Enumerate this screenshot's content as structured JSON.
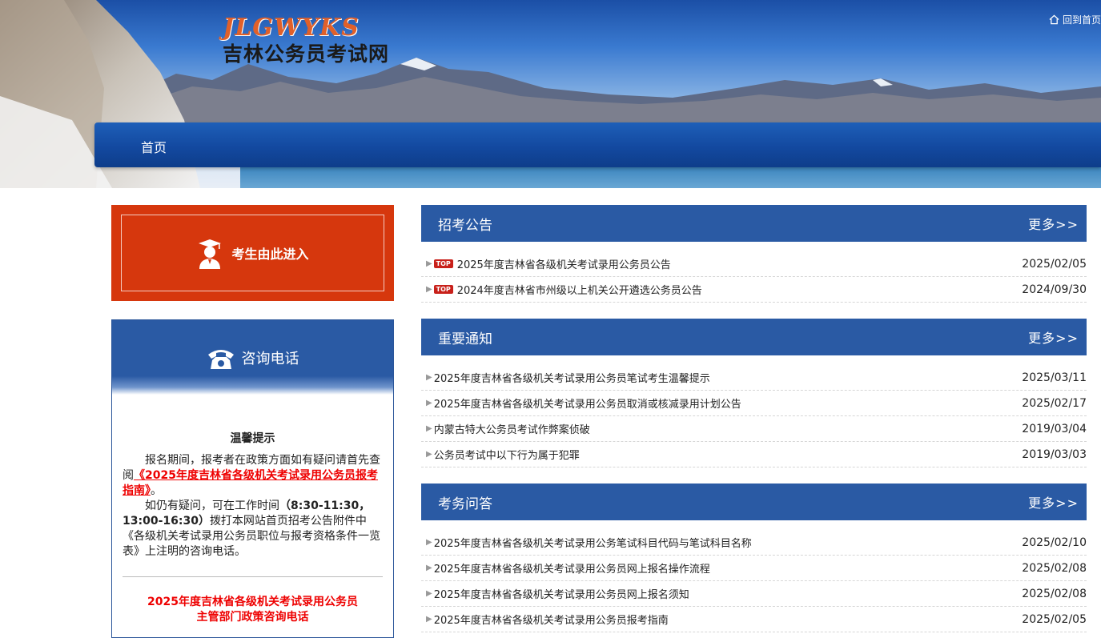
{
  "header": {
    "logo_mark": "JLGWYKS",
    "logo_sub": "吉林公务员考试网",
    "back_home": "回到首页",
    "home_icon": "home-icon"
  },
  "nav": {
    "items": [
      {
        "label": "首页"
      }
    ]
  },
  "left": {
    "enter_label": "考生由此进入",
    "enter_icon": "student-icon",
    "consult": {
      "title": "咨询电话",
      "icon": "phone-icon",
      "tip_title": "温馨提示",
      "tip_p1_pre": "报名期间，报考者在政策方面如有疑问请首先查阅",
      "tip_p1_link": "《2025年度吉林省各级机关考试录用公务员报考指南》",
      "tip_p1_post": "。",
      "tip_p2_pre": "如仍有疑问，可在工作时间",
      "tip_p2_bold": "（8:30-11:30，13:00-16:30）",
      "tip_p2_post": "拨打本网站首页招考公告附件中《各级机关考试录用公务员职位与报考资格条件一览表》上注明的咨询电话。",
      "red_title_1": "2025年度吉林省各级机关考试录用公务员",
      "red_title_2": "主管部门政策咨询电话"
    }
  },
  "sections": [
    {
      "title": "招考公告",
      "more": "更多>>",
      "items": [
        {
          "top": "TOP",
          "title": "2025年度吉林省各级机关考试录用公务员公告",
          "date": "2025/02/05"
        },
        {
          "top": "TOP",
          "title": "2024年度吉林省市州级以上机关公开遴选公务员公告",
          "date": "2024/09/30"
        }
      ]
    },
    {
      "title": "重要通知",
      "more": "更多>>",
      "items": [
        {
          "title": "2025年度吉林省各级机关考试录用公务员笔试考生温馨提示",
          "date": "2025/03/11"
        },
        {
          "title": "2025年度吉林省各级机关考试录用公务员取消或核减录用计划公告",
          "date": "2025/02/17"
        },
        {
          "title": "内蒙古特大公务员考试作弊案侦破",
          "date": "2019/03/04"
        },
        {
          "title": "公务员考试中以下行为属于犯罪",
          "date": "2019/03/03"
        }
      ]
    },
    {
      "title": "考务问答",
      "more": "更多>>",
      "items": [
        {
          "title": "2025年度吉林省各级机关考试录用公务笔试科目代码与笔试科目名称",
          "date": "2025/02/10"
        },
        {
          "title": "2025年度吉林省各级机关考试录用公务员网上报名操作流程",
          "date": "2025/02/08"
        },
        {
          "title": "2025年度吉林省各级机关考试录用公务员网上报名须知",
          "date": "2025/02/08"
        },
        {
          "title": "2025年度吉林省各级机关考试录用公务员报考指南",
          "date": "2025/02/05"
        }
      ]
    }
  ]
}
